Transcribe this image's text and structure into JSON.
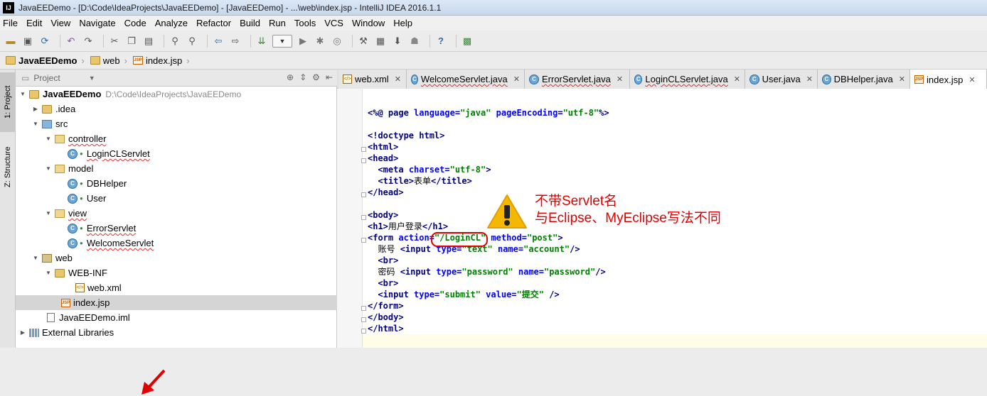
{
  "window": {
    "title": "JavaEEDemo - [D:\\Code\\IdeaProjects\\JavaEEDemo] - [JavaEEDemo] - ...\\web\\index.jsp - IntelliJ IDEA 2016.1.1",
    "logo": "IJ"
  },
  "menu": [
    "File",
    "Edit",
    "View",
    "Navigate",
    "Code",
    "Analyze",
    "Refactor",
    "Build",
    "Run",
    "Tools",
    "VCS",
    "Window",
    "Help"
  ],
  "breadcrumb": [
    "JavaEEDemo",
    "web",
    "index.jsp"
  ],
  "project_panel": {
    "title": "Project",
    "side_tabs": [
      "1: Project",
      "Z: Structure"
    ],
    "tree": [
      {
        "label": "JavaEEDemo",
        "path": "D:\\Code\\IdeaProjects\\JavaEEDemo"
      },
      {
        "label": ".idea"
      },
      {
        "label": "src"
      },
      {
        "label": "controller"
      },
      {
        "label": "LoginCLServlet"
      },
      {
        "label": "model"
      },
      {
        "label": "DBHelper"
      },
      {
        "label": "User"
      },
      {
        "label": "view"
      },
      {
        "label": "ErrorServlet"
      },
      {
        "label": "WelcomeServlet"
      },
      {
        "label": "web"
      },
      {
        "label": "WEB-INF"
      },
      {
        "label": "web.xml"
      },
      {
        "label": "index.jsp"
      },
      {
        "label": "JavaEEDemo.iml"
      },
      {
        "label": "External Libraries"
      }
    ]
  },
  "editor_tabs": [
    "web.xml",
    "WelcomeServlet.java",
    "ErrorServlet.java",
    "LoginCLServlet.java",
    "User.java",
    "DBHelper.java",
    "index.jsp"
  ],
  "code": {
    "l1_a": "<%@ ",
    "l1_b": "page",
    "l1_c": " language=",
    "l1_d": "\"java\"",
    "l1_e": " pageEncoding=",
    "l1_f": "\"utf-8\"",
    "l1_g": "%>",
    "doctype": "<!doctype html>",
    "html_open": "<html>",
    "head_open": "<head>",
    "meta_a": "<meta ",
    "meta_b": "charset=",
    "meta_c": "\"utf-8\"",
    "meta_d": ">",
    "title_a": "<title>",
    "title_b": "表单",
    "title_c": "</title>",
    "head_close": "</head>",
    "body_open": "<body>",
    "h1_a": "<h1>",
    "h1_b": "用户登录",
    "h1_c": "</h1>",
    "form_a": "<form ",
    "form_b": "action=",
    "form_c": "\"/LoginCL\"",
    "form_d": " method=",
    "form_e": "\"post\"",
    "form_f": ">",
    "acc_a": "账号 ",
    "acc_b": "<input ",
    "acc_c": "type=",
    "acc_d": "\"text\"",
    "acc_e": " name=",
    "acc_f": "\"account\"",
    "acc_g": "/>",
    "br": "<br>",
    "pw_a": "密码 ",
    "pw_b": "<input ",
    "pw_c": "type=",
    "pw_d": "\"password\"",
    "pw_e": " name=",
    "pw_f": "\"password\"",
    "pw_g": "/>",
    "sub_a": "<input ",
    "sub_b": "type=",
    "sub_c": "\"submit\"",
    "sub_d": " value=",
    "sub_e": "\"提交\"",
    "sub_f": " />",
    "form_close": "</form>",
    "body_close": "</body>",
    "html_close": "</html>"
  },
  "annotation": {
    "line1": "不带Servlet名",
    "line2": "与Eclipse、MyEclipse写法不同"
  },
  "colors": {
    "annotation_red": "#e00000",
    "tag_navy": "#000080",
    "attr_blue": "#0000ff",
    "string_green": "#008000"
  }
}
